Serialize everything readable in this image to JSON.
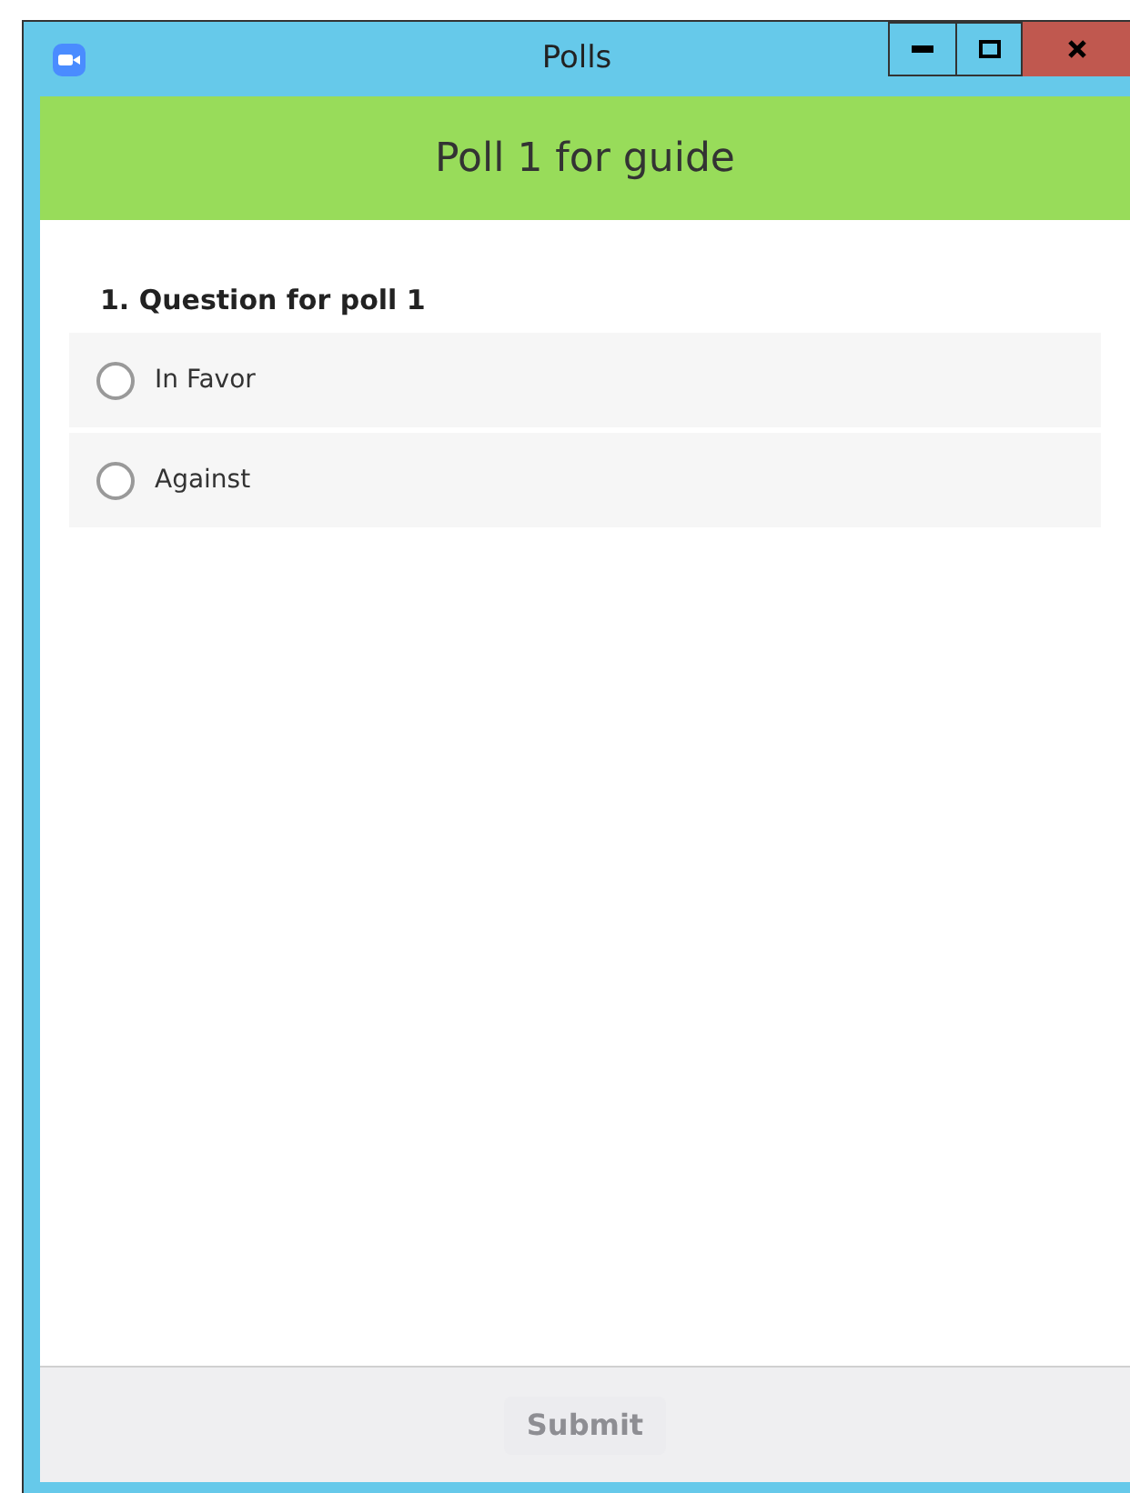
{
  "window": {
    "title": "Polls"
  },
  "poll": {
    "title": "Poll 1 for guide"
  },
  "question": {
    "text": "1. Question for poll 1",
    "options": [
      {
        "label": "In Favor",
        "selected": false
      },
      {
        "label": "Against",
        "selected": false
      }
    ]
  },
  "submit": {
    "label": "Submit",
    "disabled": true
  }
}
